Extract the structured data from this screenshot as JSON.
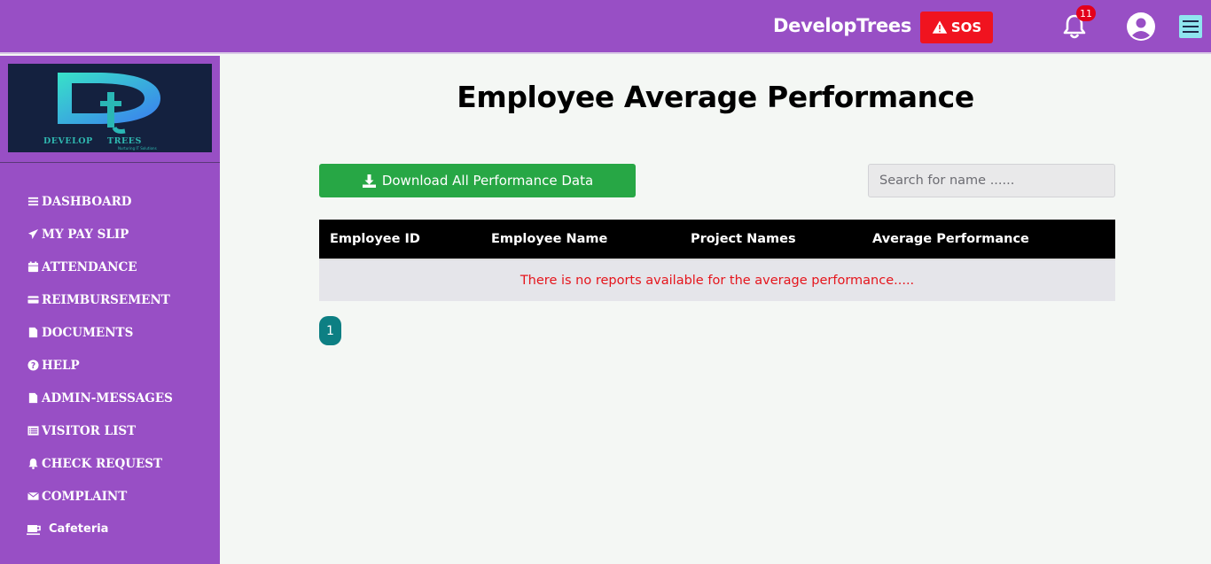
{
  "header": {
    "brand": "DevelopTrees",
    "sos_label": "SOS",
    "notification_count": "11"
  },
  "sidebar": {
    "logo": {
      "letters": "Dt",
      "wordmark": "DEVELOPTREES",
      "tagline": "Nurturing IT Solutions"
    },
    "items": [
      {
        "label": "DASHBOARD",
        "icon": "list-icon"
      },
      {
        "label": "MY PAY SLIP",
        "icon": "paper-plane-icon"
      },
      {
        "label": "ATTENDANCE",
        "icon": "calendar-icon"
      },
      {
        "label": "REIMBURSEMENT",
        "icon": "credit-card-icon"
      },
      {
        "label": "DOCUMENTS",
        "icon": "file-icon"
      },
      {
        "label": "HELP",
        "icon": "question-circle-icon"
      },
      {
        "label": "ADMIN-MESSAGES",
        "icon": "file-icon"
      },
      {
        "label": "VISITOR LIST",
        "icon": "list-table-icon"
      },
      {
        "label": "CHECK REQUEST",
        "icon": "bell-icon"
      },
      {
        "label": "COMPLAINT",
        "icon": "envelope-icon"
      },
      {
        "label": "Cafeteria",
        "icon": "coffee-cup-icon"
      }
    ]
  },
  "main": {
    "title": "Employee Average Performance",
    "download_label": "Download All Performance Data",
    "search_placeholder": "Search for name ......",
    "table": {
      "columns": [
        "Employee ID",
        "Employee Name",
        "Project Names",
        "Average Performance"
      ],
      "empty_message": "There is no reports available for the average performance....."
    },
    "pagination": {
      "current_page": "1"
    }
  },
  "colors": {
    "topbar": "#984fc5",
    "sidebar": "#984fc5",
    "sos": "#f0131f",
    "download": "#27a745",
    "table_header": "#000000",
    "empty_message": "#e5151c",
    "page_button": "#0d7f83"
  }
}
